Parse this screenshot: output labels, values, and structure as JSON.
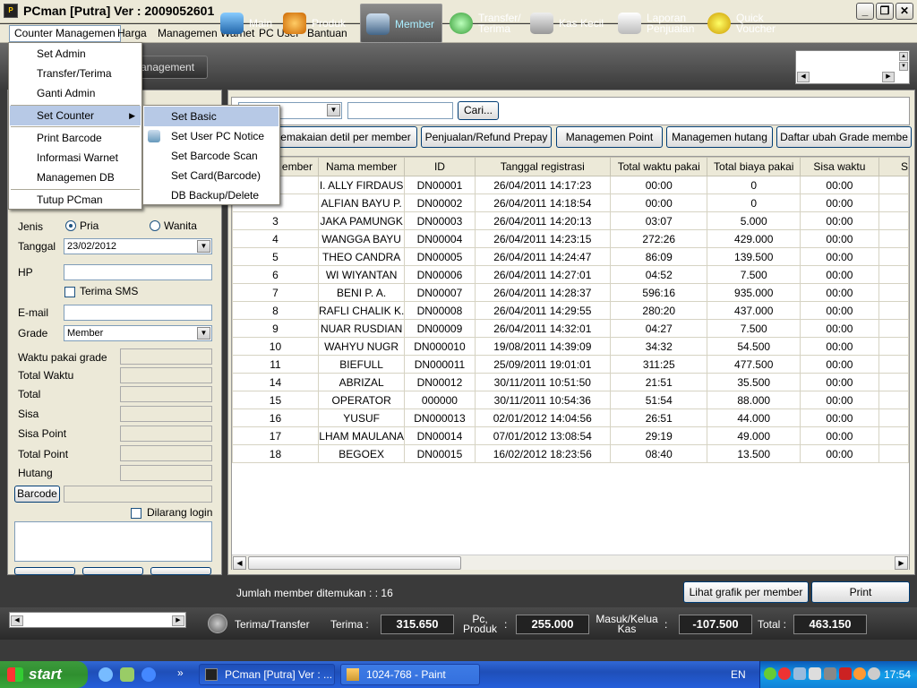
{
  "window": {
    "title": "PCman [Putra]  Ver : 2009052601"
  },
  "menubar": [
    "Counter Managemen",
    "Harga",
    "Managemen Warnet",
    "PC User",
    "Bantuan"
  ],
  "toolbar": {
    "side_button": "anagement",
    "items": [
      {
        "label": "Main",
        "icon": "monitor-icon"
      },
      {
        "label": "Produk",
        "icon": "food-icon"
      },
      {
        "label": "Member",
        "icon": "member-icon"
      },
      {
        "label": "Transfer/\nTerima",
        "icon": "transfer-icon"
      },
      {
        "label": "Kas Kecil",
        "icon": "cash-register-icon"
      },
      {
        "label": "Laporan\nPenjualan",
        "icon": "report-icon"
      },
      {
        "label": "Quick\nVoucher",
        "icon": "voucher-icon"
      }
    ]
  },
  "counter_menu": {
    "items": [
      "Set Admin",
      "Transfer/Terima",
      "Ganti Admin",
      "Set Counter",
      "Print Barcode",
      "Informasi Warnet",
      "Managemen DB",
      "Tutup PCman"
    ]
  },
  "set_counter_submenu": {
    "items": [
      "Set Basic",
      "Set User PC Notice",
      "Set Barcode Scan",
      "Set Card(Barcode)",
      "DB Backup/Delete"
    ]
  },
  "form": {
    "jenis_label": "Jenis",
    "pria": "Pria",
    "wanita": "Wanita",
    "tanggal_label": "Tanggal",
    "tanggal_value": "23/02/2012",
    "hp_label": "HP",
    "terima_sms": "Terima SMS",
    "email_label": "E-mail",
    "grade_label": "Grade",
    "grade_value": "Member",
    "waktu_pakai_grade": "Waktu pakai grade",
    "total_waktu": "Total Waktu",
    "total": "Total",
    "sisa": "Sisa",
    "sisa_point": "Sisa Point",
    "total_point": "Total Point",
    "hutang": "Hutang",
    "barcode_button": "Barcode",
    "dilarang_login": "Dilarang login"
  },
  "search": {
    "button": "Cari..."
  },
  "action_buttons": [
    "emakaian detil per member",
    "Penjualan/Refund Prepay",
    "Managemen Point",
    "Managemen hutang",
    "Daftar ubah Grade membe"
  ],
  "table": {
    "headers": [
      "ember",
      "Nama member",
      "ID",
      "Tanggal registrasi",
      "Total waktu pakai",
      "Total biaya pakai",
      "Sisa waktu",
      "S"
    ],
    "rows": [
      [
        "",
        "I. ALLY FIRDAUS",
        "DN00001",
        "26/04/2011 14:17:23",
        "00:00",
        "0",
        "00:00"
      ],
      [
        "",
        "ALFIAN BAYU P.",
        "DN00002",
        "26/04/2011 14:18:54",
        "00:00",
        "0",
        "00:00"
      ],
      [
        "3",
        "JAKA PAMUNGK",
        "DN00003",
        "26/04/2011 14:20:13",
        "03:07",
        "5.000",
        "00:00"
      ],
      [
        "4",
        "WANGGA BAYU",
        "DN00004",
        "26/04/2011 14:23:15",
        "272:26",
        "429.000",
        "00:00"
      ],
      [
        "5",
        "THEO CANDRA",
        "DN00005",
        "26/04/2011 14:24:47",
        "86:09",
        "139.500",
        "00:00"
      ],
      [
        "6",
        "WI WIYANTAN",
        "DN00006",
        "26/04/2011 14:27:01",
        "04:52",
        "7.500",
        "00:00"
      ],
      [
        "7",
        "BENI P. A.",
        "DN00007",
        "26/04/2011 14:28:37",
        "596:16",
        "935.000",
        "00:00"
      ],
      [
        "8",
        "RAFLI CHALIK K.",
        "DN00008",
        "26/04/2011 14:29:55",
        "280:20",
        "437.000",
        "00:00"
      ],
      [
        "9",
        "NUAR RUSDIAN",
        "DN00009",
        "26/04/2011 14:32:01",
        "04:27",
        "7.500",
        "00:00"
      ],
      [
        "10",
        "WAHYU NUGR",
        "DN000010",
        "19/08/2011 14:39:09",
        "34:32",
        "54.500",
        "00:00"
      ],
      [
        "11",
        "BIEFULL",
        "DN000011",
        "25/09/2011 19:01:01",
        "311:25",
        "477.500",
        "00:00"
      ],
      [
        "14",
        "ABRIZAL",
        "DN00012",
        "30/11/2011 10:51:50",
        "21:51",
        "35.500",
        "00:00"
      ],
      [
        "15",
        "OPERATOR",
        "000000",
        "30/11/2011 10:54:36",
        "51:54",
        "88.000",
        "00:00"
      ],
      [
        "16",
        "YUSUF",
        "DN000013",
        "02/01/2012 14:04:56",
        "26:51",
        "44.000",
        "00:00"
      ],
      [
        "17",
        "LHAM MAULANA",
        "DN00014",
        "07/01/2012 13:08:54",
        "29:19",
        "49.000",
        "00:00"
      ],
      [
        "18",
        "BEGOEX",
        "DN00015",
        "16/02/2012 18:23:56",
        "08:40",
        "13.500",
        "00:00"
      ]
    ]
  },
  "status": {
    "found": "Jumlah member ditemukan : : 16",
    "grafik_button": "Lihat grafik per member",
    "print_button": "Print"
  },
  "bottombar": {
    "terima_transfer": "Terima/Transfer",
    "terima_label": "Terima :",
    "terima_value": "315.650",
    "pc_produk_label": "Pc,\nProduk",
    "colon": ":",
    "pc_produk_value": "255.000",
    "masuk_keluar_label": "Masuk/Kelua\nKas",
    "masuk_keluar_value": "-107.500",
    "total_label": "Total :",
    "total_value": "463.150"
  },
  "taskbar": {
    "start": "start",
    "tasks": [
      "PCman [Putra]  Ver : ...",
      "1024-768 - Paint"
    ],
    "lang": "EN",
    "clock": "17:54"
  }
}
